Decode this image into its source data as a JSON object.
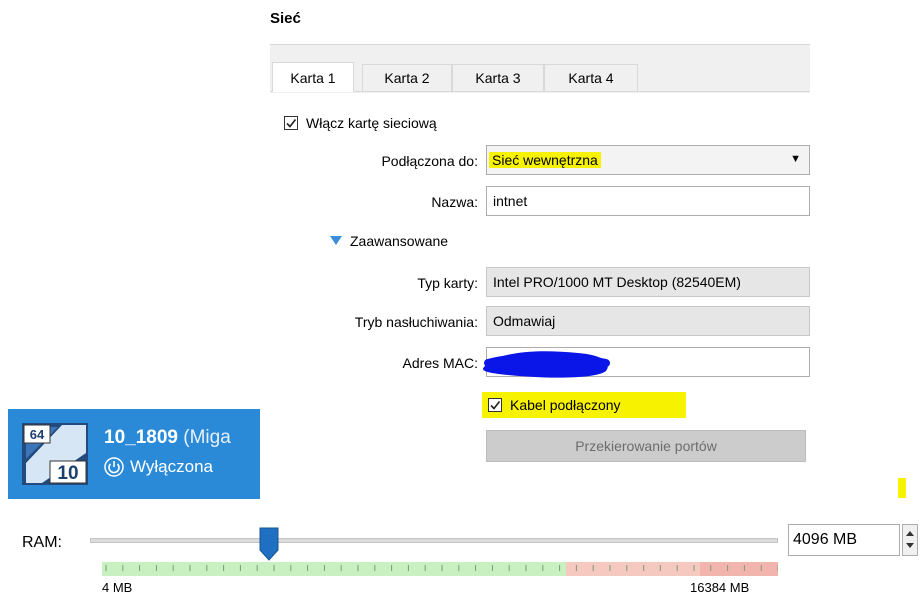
{
  "section": {
    "title": "Sieć"
  },
  "tabs": [
    {
      "label": "Karta 1",
      "active": true
    },
    {
      "label": "Karta 2",
      "active": false
    },
    {
      "label": "Karta 3",
      "active": false
    },
    {
      "label": "Karta 4",
      "active": false
    }
  ],
  "adapter": {
    "enable_label": "Włącz kartę sieciową",
    "enable_checked": true,
    "attached_label": "Podłączona do:",
    "attached_value": "Sieć wewnętrzna",
    "name_label": "Nazwa:",
    "name_value": "intnet",
    "advanced_label": "Zaawansowane",
    "type_label": "Typ karty:",
    "type_value": "Intel PRO/1000 MT Desktop (82540EM)",
    "promisc_label": "Tryb nasłuchiwania:",
    "promisc_value": "Odmawiaj",
    "mac_label": "Adres MAC:",
    "mac_value": "",
    "cable_label": "Kabel podłączony",
    "cable_checked": true,
    "port_forwarding_label": "Przekierowanie portów"
  },
  "vm": {
    "name": "10_1809",
    "name_suffix": "(Miga",
    "status": "Wyłączona",
    "badge_arch": "64",
    "badge_version": "10"
  },
  "ram": {
    "label": "RAM:",
    "value": "4096 MB",
    "min_label": "4 MB",
    "max_label": "16384 MB",
    "value_mb": 4096,
    "min_mb": 4,
    "max_mb": 16384
  },
  "colors": {
    "highlight": "#f6f200",
    "vm_tile": "#2a8ad8",
    "mac_redaction": "#0a16e8",
    "ram_ok": "#c8f0c0",
    "ram_warn": "#f5c9bf",
    "slider_thumb": "#1f6fc2"
  }
}
